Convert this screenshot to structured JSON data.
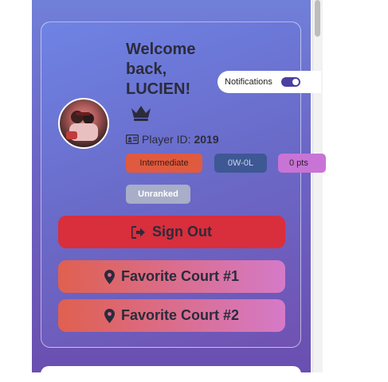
{
  "profile": {
    "welcome_line1": "Welcome",
    "welcome_line2": "back,",
    "welcome_line3": "LUCIEN!",
    "player_id_label": "Player ID:",
    "player_id_value": "2019"
  },
  "notifications": {
    "label": "Notifications",
    "enabled": true
  },
  "badges": {
    "level": "Intermediate",
    "record": "0W-0L",
    "points": "0 pts",
    "rank": "Unranked"
  },
  "actions": {
    "sign_out": "Sign Out",
    "court1": "Favorite Court #1",
    "court2": "Favorite Court #2"
  },
  "icons": {
    "crown": "crown-icon",
    "id_card": "id-card-icon",
    "sign_out": "sign-out-icon",
    "location": "map-pin-icon"
  },
  "colors": {
    "sign_out": "#d92e3c",
    "level_badge": "#e05a3f",
    "record_badge": "#3e5894",
    "points_badge": "#c874d6",
    "rank_badge": "#a8adc8",
    "toggle_on": "#4b3fa0"
  }
}
